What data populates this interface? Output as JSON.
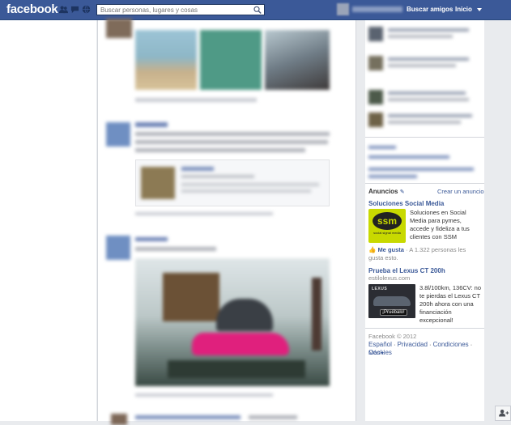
{
  "topbar": {
    "logo": "facebook",
    "search_placeholder": "Buscar personas, lugares y cosas",
    "find_friends": "Buscar amigos",
    "home": "Inicio"
  },
  "ads": {
    "title": "Anuncios",
    "create": "Crear un anuncio",
    "items": [
      {
        "title": "Soluciones Social Media",
        "text": "Soluciones en Social Media para pymes, accede y fideliza a tus clientes con SSM",
        "image_text": "ssm",
        "image_sub": "social signal media",
        "like": "Me gusta",
        "like_count": "· A 1.322 personas les gusta esto."
      },
      {
        "title": "Prueba el Lexus CT 200h",
        "domain": "estilolexus.com",
        "text": "3.8l/100km, 136CV: no te pierdas el Lexus CT 200h ahora con una financiación excepcional!",
        "image_brand": "LEXUS",
        "image_cta": "¡Pruébalo!"
      }
    ]
  },
  "footer": {
    "copyright": "Facebook © 2012",
    "links": [
      "Español",
      "Privacidad",
      "Condiciones",
      "Cookies"
    ],
    "more": "Más"
  },
  "colors": {
    "brand_blue": "#3b5998",
    "link_blue": "#3b5998",
    "ssm_green": "#c8d900"
  }
}
